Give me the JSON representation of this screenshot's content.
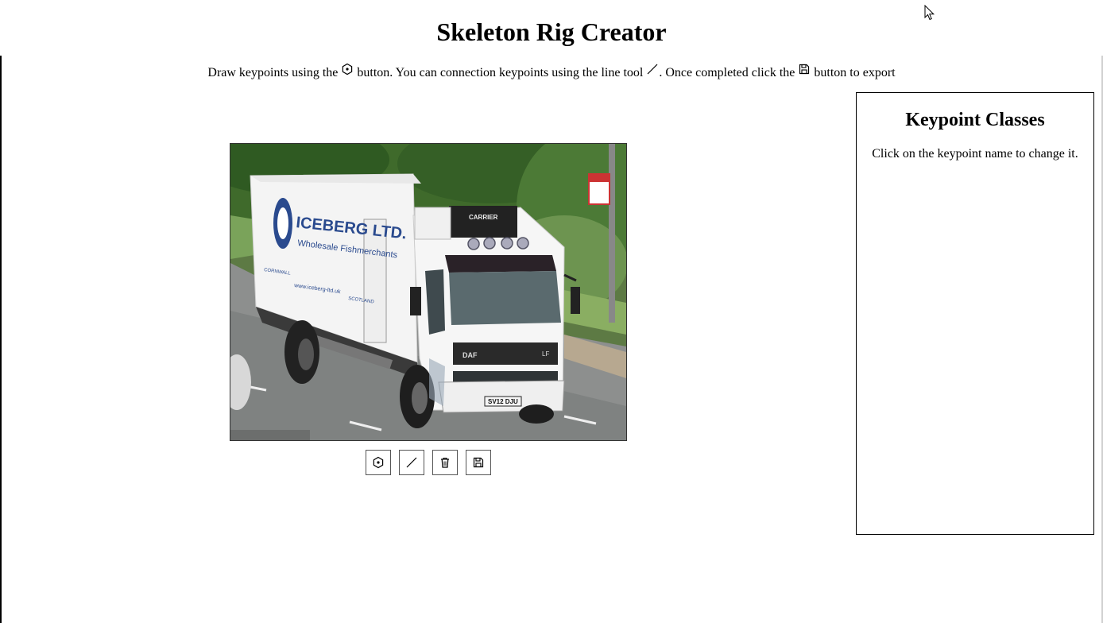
{
  "page": {
    "title": "Skeleton Rig Creator",
    "instructions": {
      "part1": "Draw keypoints using the ",
      "keypoint_icon": "keypoint-icon",
      "part2": " button. You can connection keypoints using the line tool ",
      "line_icon": "line-icon",
      "part3": ". Once completed click the ",
      "save_icon": "save-icon",
      "part4": " button to export"
    }
  },
  "canvas": {
    "image_subject": "white box truck on road",
    "truck_brand": "ICEBERG LTD.",
    "truck_tagline": "Wholesale Fishmerchants",
    "truck_website": "www.iceberg-ltd.uk",
    "truck_region_left": "CORNWALL",
    "truck_region_right": "SCOTLAND",
    "cab_badge": "DAF",
    "cab_model": "LF",
    "unit_brand": "CARRIER",
    "plate": "SV12 DJU"
  },
  "toolbar": {
    "buttons": [
      {
        "name": "keypoint-tool-button",
        "icon": "keypoint-icon"
      },
      {
        "name": "line-tool-button",
        "icon": "line-icon"
      },
      {
        "name": "delete-button",
        "icon": "trash-icon"
      },
      {
        "name": "save-button",
        "icon": "save-icon"
      }
    ]
  },
  "side_panel": {
    "title": "Keypoint Classes",
    "hint": "Click on the keypoint name to change it."
  },
  "colors": {
    "background": "#ffffff",
    "text": "#000000",
    "border": "#000000"
  }
}
